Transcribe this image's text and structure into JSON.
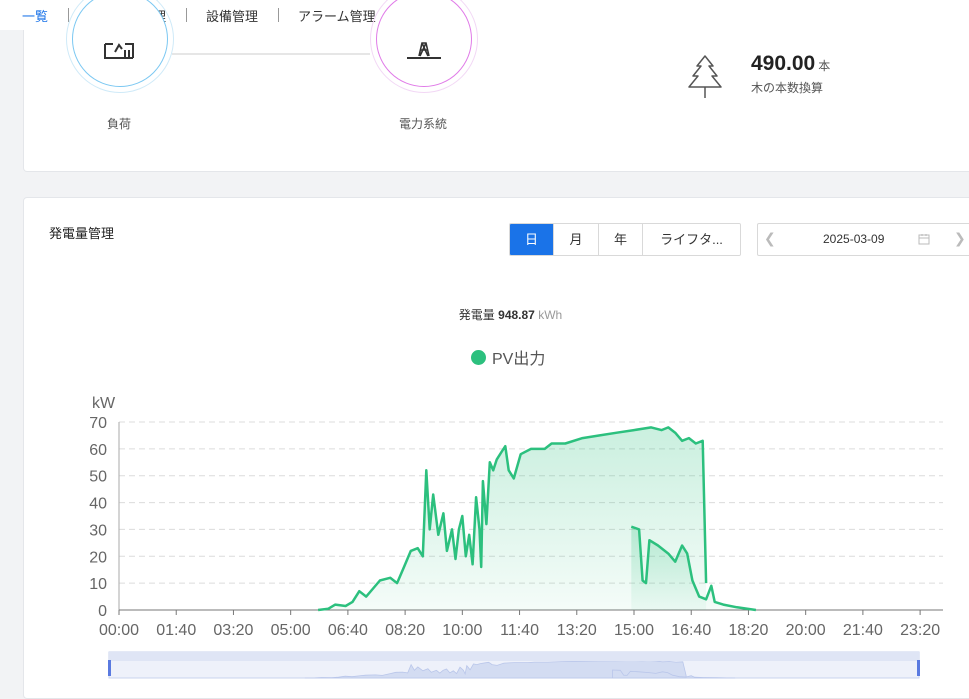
{
  "topnav": {
    "tabs": [
      "一覧",
      "レポート管理",
      "設備管理",
      "アラーム管理"
    ]
  },
  "flow": {
    "load_label": "負荷",
    "grid_label": "電力系統"
  },
  "trees": {
    "value": "490.00",
    "unit": "本",
    "caption": "木の本数換算"
  },
  "generation": {
    "title": "発電量管理",
    "periods": [
      "日",
      "月",
      "年",
      "ライフタ..."
    ],
    "active_period": "日",
    "date": "2025-03-09",
    "total_label": "発電量",
    "total_value": "948.87",
    "total_unit": "kWh",
    "icons": {
      "prev": "chevron-left-icon",
      "calendar": "calendar-icon",
      "next": "chevron-right-icon",
      "tree": "tree-icon",
      "load": "load-icon",
      "grid": "transmission-tower-icon"
    }
  },
  "chart_data": {
    "type": "area",
    "ylabel": "kW",
    "ylim": [
      0,
      70
    ],
    "yticks": [
      "0",
      "10",
      "20",
      "30",
      "40",
      "50",
      "60",
      "70"
    ],
    "xticks": [
      "00:00",
      "01:40",
      "03:20",
      "05:00",
      "06:40",
      "08:20",
      "10:00",
      "11:40",
      "13:20",
      "15:00",
      "16:40",
      "18:20",
      "20:00",
      "21:40",
      "23:20"
    ],
    "grid": true,
    "legend": "top-center",
    "series": [
      {
        "name": "PV出力",
        "color": "#2cc07e",
        "segments": [
          [
            [
              5.8,
              0
            ],
            [
              6.1,
              0.5
            ],
            [
              6.3,
              2
            ],
            [
              6.6,
              1.5
            ],
            [
              6.8,
              3
            ],
            [
              7.0,
              7
            ],
            [
              7.2,
              5
            ],
            [
              7.4,
              8
            ],
            [
              7.6,
              11
            ],
            [
              7.9,
              12
            ],
            [
              8.1,
              10
            ],
            [
              8.3,
              16
            ],
            [
              8.5,
              22
            ],
            [
              8.7,
              23
            ],
            [
              8.85,
              20
            ],
            [
              8.95,
              52
            ],
            [
              9.05,
              30
            ],
            [
              9.15,
              43
            ],
            [
              9.3,
              28
            ],
            [
              9.45,
              36
            ],
            [
              9.55,
              22
            ],
            [
              9.7,
              30
            ],
            [
              9.8,
              19
            ],
            [
              9.9,
              30
            ],
            [
              10.0,
              35
            ],
            [
              10.1,
              20
            ],
            [
              10.2,
              28
            ],
            [
              10.3,
              17
            ],
            [
              10.4,
              42
            ],
            [
              10.5,
              30
            ],
            [
              10.55,
              16
            ],
            [
              10.6,
              48
            ],
            [
              10.7,
              32
            ],
            [
              10.8,
              55
            ],
            [
              10.9,
              52
            ],
            [
              11.0,
              56
            ],
            [
              11.15,
              59
            ],
            [
              11.25,
              61
            ],
            [
              11.35,
              52
            ],
            [
              11.5,
              49
            ],
            [
              11.7,
              58
            ],
            [
              12.0,
              60
            ],
            [
              12.4,
              60
            ],
            [
              12.6,
              62
            ],
            [
              13.0,
              62
            ],
            [
              13.5,
              64
            ],
            [
              14.0,
              65
            ],
            [
              14.5,
              66
            ],
            [
              15.0,
              67
            ],
            [
              15.5,
              68
            ],
            [
              15.8,
              67
            ],
            [
              16.0,
              68
            ],
            [
              16.2,
              66
            ],
            [
              16.4,
              63
            ],
            [
              16.6,
              64
            ],
            [
              16.8,
              62
            ],
            [
              17.0,
              63
            ],
            [
              17.1,
              10
            ]
          ],
          [
            [
              14.92,
              31
            ],
            [
              15.15,
              30
            ],
            [
              15.25,
              11
            ],
            [
              15.35,
              10
            ],
            [
              15.45,
              26
            ],
            [
              15.7,
              24
            ],
            [
              16.0,
              21
            ],
            [
              16.2,
              18
            ],
            [
              16.4,
              24
            ],
            [
              16.55,
              21
            ],
            [
              16.7,
              11
            ],
            [
              16.9,
              5
            ],
            [
              17.1,
              4
            ],
            [
              17.25,
              9
            ],
            [
              17.35,
              3
            ],
            [
              17.6,
              2
            ],
            [
              18.0,
              1
            ],
            [
              18.3,
              0.5
            ],
            [
              18.55,
              0
            ]
          ]
        ]
      }
    ]
  }
}
